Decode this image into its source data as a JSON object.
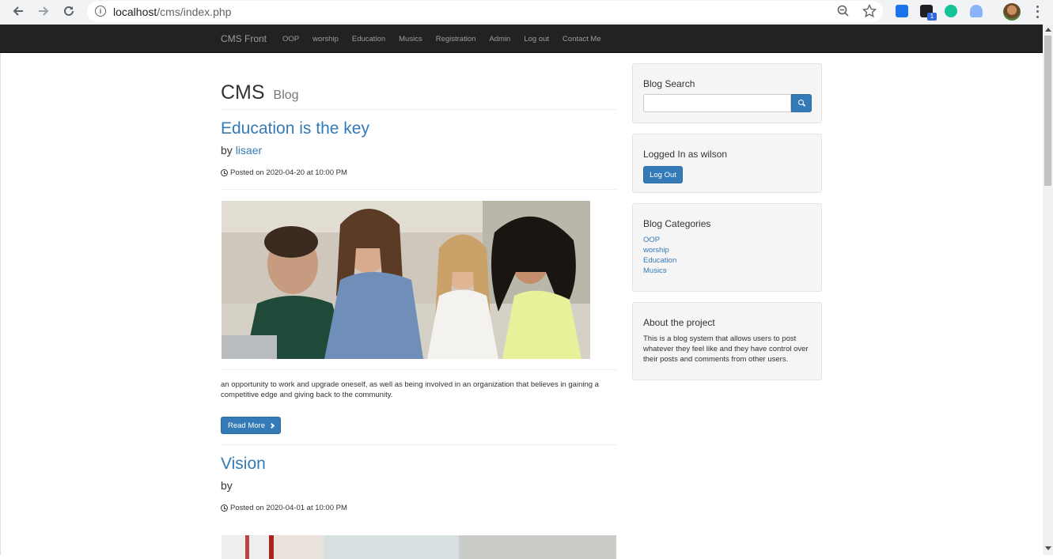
{
  "browser": {
    "url_host": "localhost",
    "url_path": "/cms/index.php",
    "extension_badge": "1"
  },
  "navbar": {
    "brand": "CMS Front",
    "links": [
      "OOP",
      "worship",
      "Education",
      "Musics",
      "Registration",
      "Admin",
      "Log out",
      "Contact Me"
    ]
  },
  "header": {
    "title": "CMS",
    "subtitle": "Blog"
  },
  "posts": [
    {
      "title": "Education is the key",
      "by_label": "by",
      "author": "lisaer",
      "date": "Posted on 2020-04-20 at 10:00 PM",
      "excerpt": "an opportunity to work and upgrade oneself, as well as being involved in an organization that believes in gaining a competitive edge and giving back to the community.",
      "read_more": "Read More"
    },
    {
      "title": "Vision",
      "by_label": "by",
      "author": "",
      "date": "Posted on 2020-04-01 at 10:00 PM"
    }
  ],
  "sidebar": {
    "search_title": "Blog Search",
    "search_placeholder": "",
    "logged_in": "Logged In as wilson",
    "logout_label": "Log Out",
    "categories_title": "Blog Categories",
    "categories": [
      "OOP",
      "worship",
      "Education",
      "Musics"
    ],
    "about_title": "About the project",
    "about_text": "This is a blog system that allows users to post whatever they feel like and they have control over their posts and comments from other users."
  }
}
